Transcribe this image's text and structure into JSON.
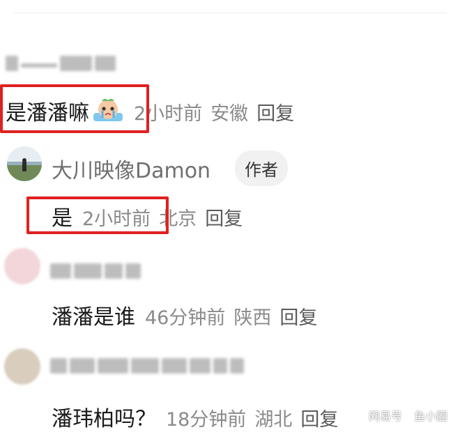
{
  "comments": [
    {
      "text": "是潘潘嘛",
      "time": "2小时前",
      "location": "安徽",
      "reply_label": "回复"
    },
    {
      "author": "大川映像Damon",
      "badge": "作者",
      "text": "是",
      "time": "2小时前",
      "location": "北京",
      "reply_label": "回复"
    },
    {
      "text": "潘潘是谁",
      "time": "46分钟前",
      "location": "陕西",
      "reply_label": "回复"
    },
    {
      "text": "潘玮柏吗？",
      "time": "18分钟前",
      "location": "湖北",
      "reply_label": "回复"
    }
  ],
  "watermark": {
    "left": "网易号",
    "right": "鱼小圈"
  },
  "colors": {
    "highlight_box": "#e0201f",
    "meta_text": "#8a8a8a",
    "badge_bg": "#f1f1f1"
  }
}
